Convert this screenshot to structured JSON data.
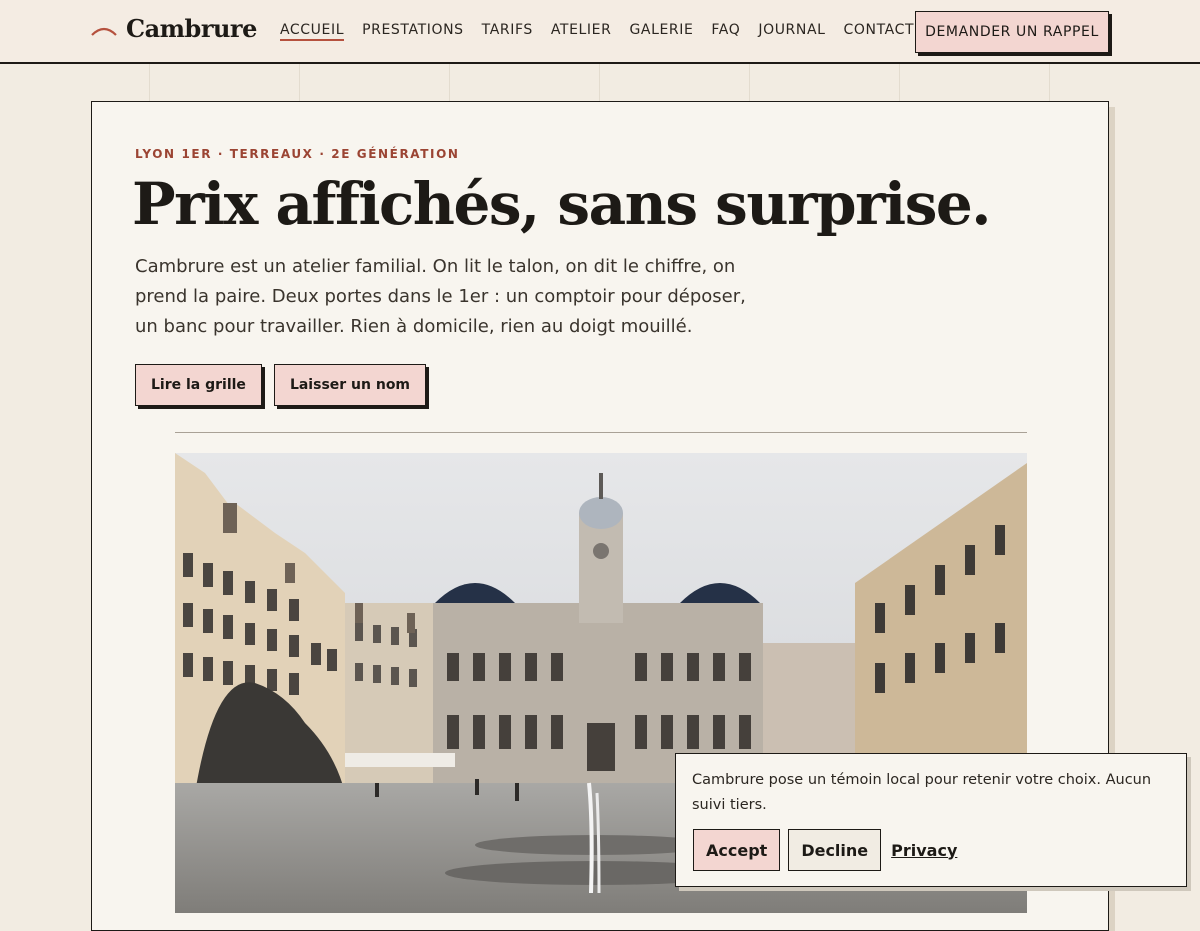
{
  "header": {
    "brand": "Cambrure",
    "nav": [
      "ACCUEIL",
      "PRESTATIONS",
      "TARIFS",
      "ATELIER",
      "GALERIE",
      "FAQ",
      "JOURNAL",
      "CONTACT"
    ],
    "active_nav": "ACCUEIL",
    "cta_label": "DEMANDER UN RAPPEL"
  },
  "hero": {
    "eyebrow": "LYON 1ER · TERREAUX · 2E GÉNÉRATION",
    "title": "Prix affichés, sans surprise.",
    "lead": "Cambrure est un atelier familial. On lit le talon, on dit le chiffre, on prend la paire. Deux portes dans le 1er : un comptoir pour déposer, un banc pour travailler. Rien à domicile, rien au doigt mouillé.",
    "primary_label": "Lire la grille",
    "secondary_label": "Laisser un nom"
  },
  "cookie": {
    "text": "Cambrure pose un témoin local pour retenir votre choix. Aucun suivi tiers.",
    "accept_label": "Accept",
    "decline_label": "Decline",
    "privacy_label": "Privacy"
  },
  "colors": {
    "accent": "#b5513e",
    "button_fill": "#f3d6d1",
    "ink": "#1d1a16",
    "paper": "#f8f5ef",
    "page_bg": "#f2ece2"
  },
  "icons": {
    "brand_mark": "arc-logo-icon"
  }
}
